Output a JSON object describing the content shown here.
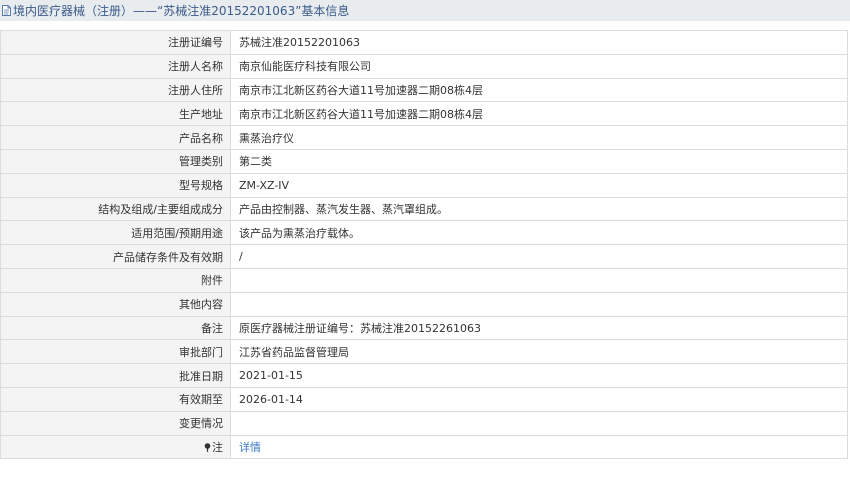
{
  "header": {
    "icon": "document-icon",
    "title": "境内医疗器械（注册）——“苏械注准20152201063”基本信息"
  },
  "rows": [
    {
      "label": "注册证编号",
      "value": "苏械注准20152201063"
    },
    {
      "label": "注册人名称",
      "value": "南京仙能医疗科技有限公司"
    },
    {
      "label": "注册人住所",
      "value": "南京市江北新区药谷大道11号加速器二期08栋4层"
    },
    {
      "label": "生产地址",
      "value": "南京市江北新区药谷大道11号加速器二期08栋4层"
    },
    {
      "label": "产品名称",
      "value": "熏蒸治疗仪"
    },
    {
      "label": "管理类别",
      "value": "第二类"
    },
    {
      "label": "型号规格",
      "value": "ZM-XZ-IV"
    },
    {
      "label": "结构及组成/主要组成成分",
      "value": "产品由控制器、蒸汽发生器、蒸汽罩组成。"
    },
    {
      "label": "适用范围/预期用途",
      "value": "该产品为熏蒸治疗载体。"
    },
    {
      "label": "产品储存条件及有效期",
      "value": "/"
    },
    {
      "label": "附件",
      "value": ""
    },
    {
      "label": "其他内容",
      "value": ""
    },
    {
      "label": "备注",
      "value": "原医疗器械注册证编号：苏械注准20152261063"
    },
    {
      "label": "审批部门",
      "value": "江苏省药品监督管理局"
    },
    {
      "label": "批准日期",
      "value": "2021-01-15"
    },
    {
      "label": "有效期至",
      "value": "2026-01-14"
    },
    {
      "label": "变更情况",
      "value": ""
    }
  ],
  "note_row": {
    "icon": "pin-icon",
    "label": "注",
    "link_text": "详情"
  },
  "colors": {
    "title_bar_bg": "#e9ecef",
    "title_text": "#3a5a8a",
    "label_bg": "#f4f4f4",
    "border": "#dcdcdc",
    "link": "#3a78c3"
  }
}
